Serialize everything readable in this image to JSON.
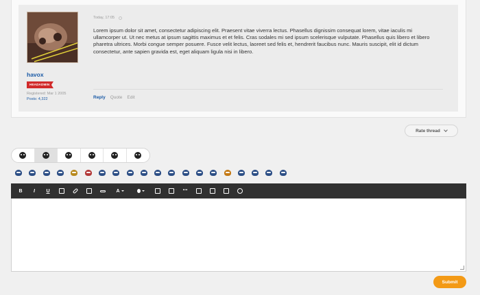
{
  "post": {
    "timestamp": "Today, 17:05",
    "body": "Lorem ipsum dolor sit amet, consectetur adipiscing elit. Praesent vitae viverra lectus. Phasellus dignissim consequat lorem, vitae iaculis mi ullamcorper ut. Ut nec metus at ipsum sagittis maximus et et felis. Cras sodales mi sed ipsum scelerisque vulputate. Phasellus quis libero et libero pharetra ultrices. Morbi congue semper posuere. Fusce velit lectus, laoreet sed felis et, hendrerit faucibus nunc. Mauris suscipit, elit id dictum consectetur, ante sapien gravida est, eget aliquam ligula nisi in libero.",
    "actions": {
      "reply": "Reply",
      "quote": "Quote",
      "edit": "Edit"
    }
  },
  "author": {
    "username": "havox",
    "rank": "HEADADMIN",
    "registered": "Registered: Mar 1 2005",
    "posts": "Posts: 4,322"
  },
  "rate_thread": "Rate thread",
  "emoticon_tabs": [
    "tab-1",
    "tab-2",
    "tab-3",
    "tab-4",
    "tab-5",
    "tab-6"
  ],
  "smilies_count": 20,
  "toolbar": {
    "bold": "B",
    "italic": "I",
    "underline": "U",
    "font_size": "A",
    "quote": "““"
  },
  "submit_label": "Submit",
  "colors": {
    "accent": "#f39a16",
    "link": "#1a5aa6",
    "rank": "#d12b2b",
    "toolbar": "#303030"
  }
}
